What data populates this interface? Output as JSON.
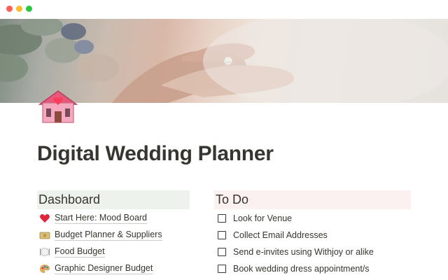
{
  "window": {
    "controls": [
      "close",
      "minimize",
      "zoom"
    ],
    "colors": {
      "close": "#fe5f57",
      "minimize": "#febc2e",
      "zoom": "#28c840"
    }
  },
  "cover": {
    "image": "wedding-ring-hands-photo"
  },
  "page": {
    "icon": "pink-house-heart-icon",
    "title": "Digital Wedding Planner"
  },
  "dashboard": {
    "heading": "Dashboard",
    "heading_bg": "#edf3ec",
    "items": [
      {
        "icon": "red-heart-icon",
        "label": "Start Here: Mood Board"
      },
      {
        "icon": "money-icon",
        "label": "Budget Planner & Suppliers"
      },
      {
        "icon": "plate-cutlery-icon",
        "label": "Food Budget"
      },
      {
        "icon": "artist-palette-icon",
        "label": "Graphic Designer Budget"
      }
    ]
  },
  "todo": {
    "heading": "To Do",
    "heading_bg": "#fbf1f1",
    "items": [
      {
        "label": "Look for Venue",
        "checked": false
      },
      {
        "label": "Collect Email Addresses",
        "checked": false
      },
      {
        "label": "Send e-invites using Withjoy or alike",
        "checked": false
      },
      {
        "label": "Book wedding dress appointment/s",
        "checked": false
      }
    ]
  }
}
